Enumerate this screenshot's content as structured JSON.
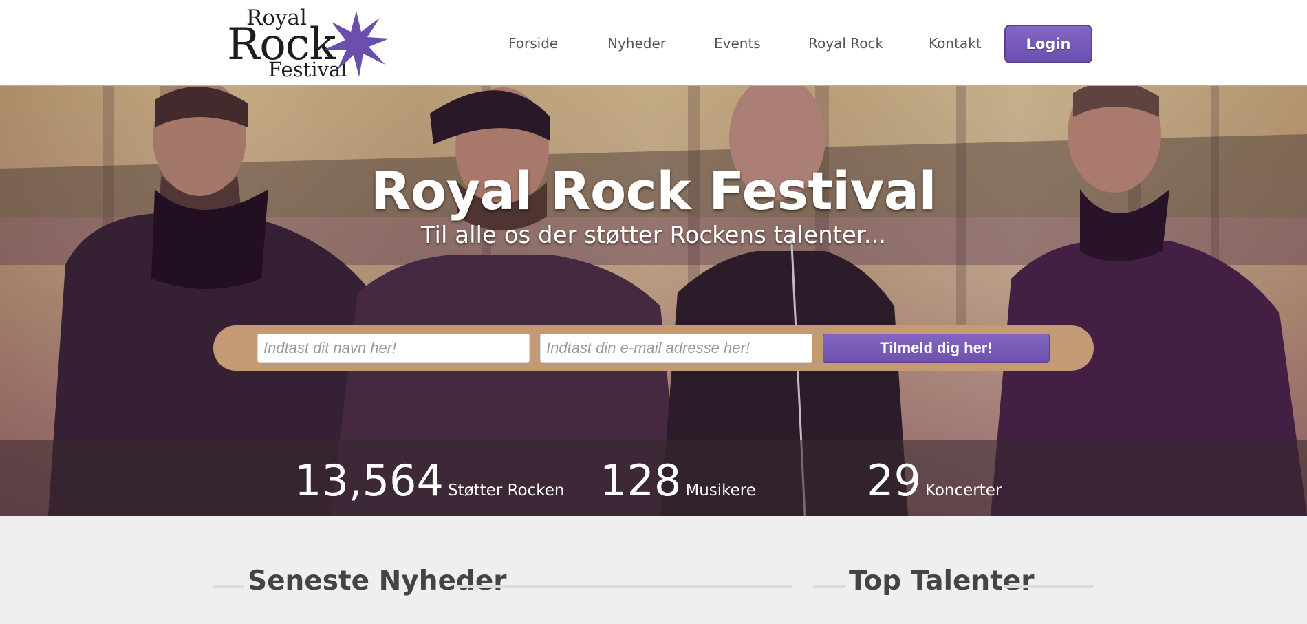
{
  "logo": {
    "line1": "Royal",
    "line2": "Rock",
    "line3": "Festival"
  },
  "nav": {
    "items": [
      "Forside",
      "Nyheder",
      "Events",
      "Royal Rock",
      "Kontakt"
    ],
    "login": "Login"
  },
  "hero": {
    "title": "Royal Rock Festival",
    "subtitle": "Til alle os der støtter Rockens talenter..."
  },
  "signup": {
    "name_placeholder": "Indtast dit navn her!",
    "email_placeholder": "Indtast din e-mail adresse her!",
    "button": "Tilmeld dig her!"
  },
  "stats": [
    {
      "value": "13,564",
      "label": "Støtter Rocken"
    },
    {
      "value": "128",
      "label": "Musikere"
    },
    {
      "value": "29",
      "label": "Koncerter"
    }
  ],
  "sections": {
    "news_title": "Seneste Nyheder",
    "talents_title": "Top Talenter"
  },
  "colors": {
    "accent": "#6b4fae",
    "signup_bar": "#c39a74",
    "lower_bg": "#efefef"
  }
}
